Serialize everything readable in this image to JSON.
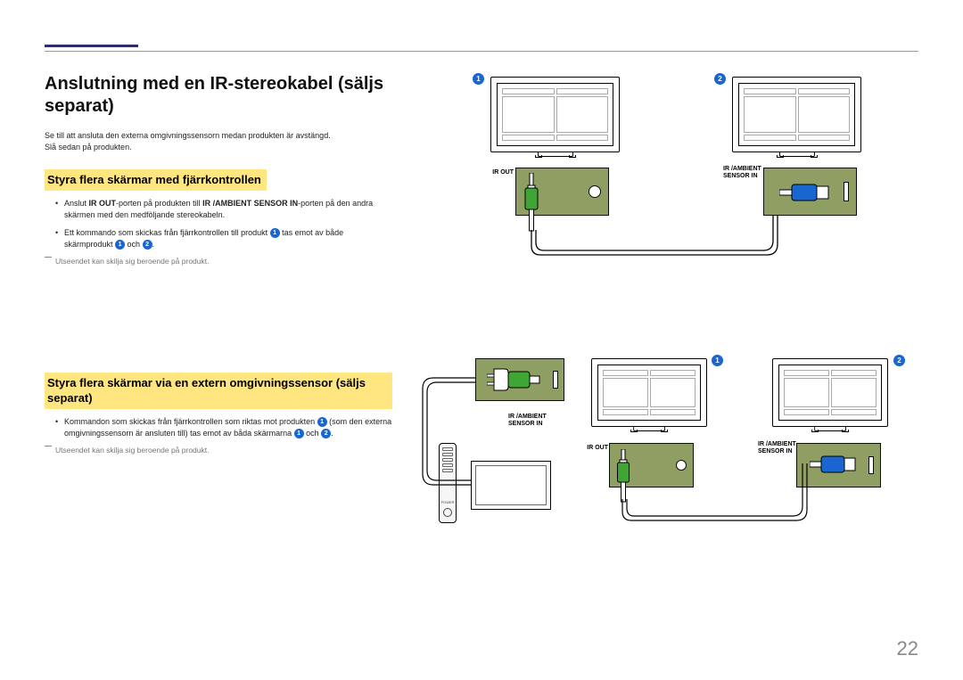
{
  "title": "Anslutning med en IR-stereokabel (säljs separat)",
  "intro_l1": "Se till att ansluta den externa omgivningssensorn medan produkten är avstängd.",
  "intro_l2": "Slå sedan på produkten.",
  "sec1": {
    "heading": "Styra flera skärmar med fjärrkontrollen",
    "b1a": "Anslut ",
    "b1b": "IR OUT",
    "b1c": "-porten på produkten till ",
    "b1d": "IR /AMBIENT SENSOR IN",
    "b1e": "-porten på den andra skärmen med den medföljande stereokabeln.",
    "b2a": "Ett kommando som skickas från fjärrkontrollen till produkt ",
    "b2b": " tas emot av både skärmprodukt ",
    "b2c": " och ",
    "b2d": ".",
    "note": "Utseendet kan skilja sig beroende på produkt."
  },
  "sec2": {
    "heading": "Styra flera skärmar via en extern omgivningssensor (säljs separat)",
    "b1a": "Kommandon som skickas från fjärrkontrollen som riktas mot produkten ",
    "b1b": " (som den externa omgivningssensorn är ansluten till) tas emot av båda skärmarna ",
    "b1c": " och ",
    "b1d": ".",
    "note": "Utseendet kan skilja sig beroende på produkt."
  },
  "labels": {
    "ir_out": "IR OUT",
    "ir_amb": "IR /AMBIENT",
    "sensor_in": "SENSOR IN",
    "power": "POWER"
  },
  "badges": {
    "n1": "1",
    "n2": "2"
  },
  "page_number": "22"
}
